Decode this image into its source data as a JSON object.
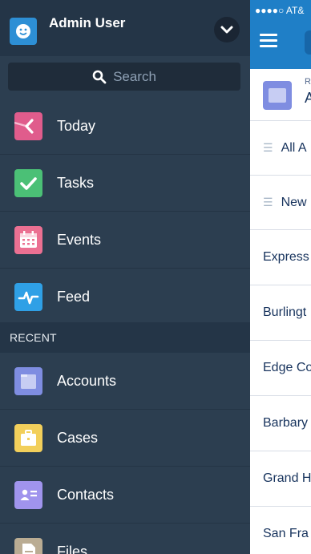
{
  "status_bar": {
    "carrier": "●●●●○ AT&"
  },
  "user": {
    "name": "Admin User"
  },
  "search": {
    "placeholder": "Search"
  },
  "nav_items": [
    {
      "label": "Today",
      "icon": "today-icon",
      "color": "#e05c8c"
    },
    {
      "label": "Tasks",
      "icon": "checkmark-icon",
      "color": "#4bc076"
    },
    {
      "label": "Events",
      "icon": "calendar-icon",
      "color": "#eb7092"
    },
    {
      "label": "Feed",
      "icon": "pulse-icon",
      "color": "#2fa0e6"
    }
  ],
  "recent_section": {
    "label": "RECENT"
  },
  "recent_items": [
    {
      "label": "Accounts",
      "icon": "folder-icon",
      "color": "#7f8de1"
    },
    {
      "label": "Cases",
      "icon": "briefcase-icon",
      "color": "#f2cf5b"
    },
    {
      "label": "Contacts",
      "icon": "contact-card-icon",
      "color": "#a094ed"
    },
    {
      "label": "Files",
      "icon": "file-icon",
      "color": "#baac93"
    }
  ],
  "background_app": {
    "header_small": "R",
    "header_big": "A",
    "views": [
      "All A",
      "New"
    ],
    "rows": [
      "Express",
      "Burlingt",
      "Edge Co",
      "Barbary",
      "Grand H",
      "San Fra"
    ]
  }
}
